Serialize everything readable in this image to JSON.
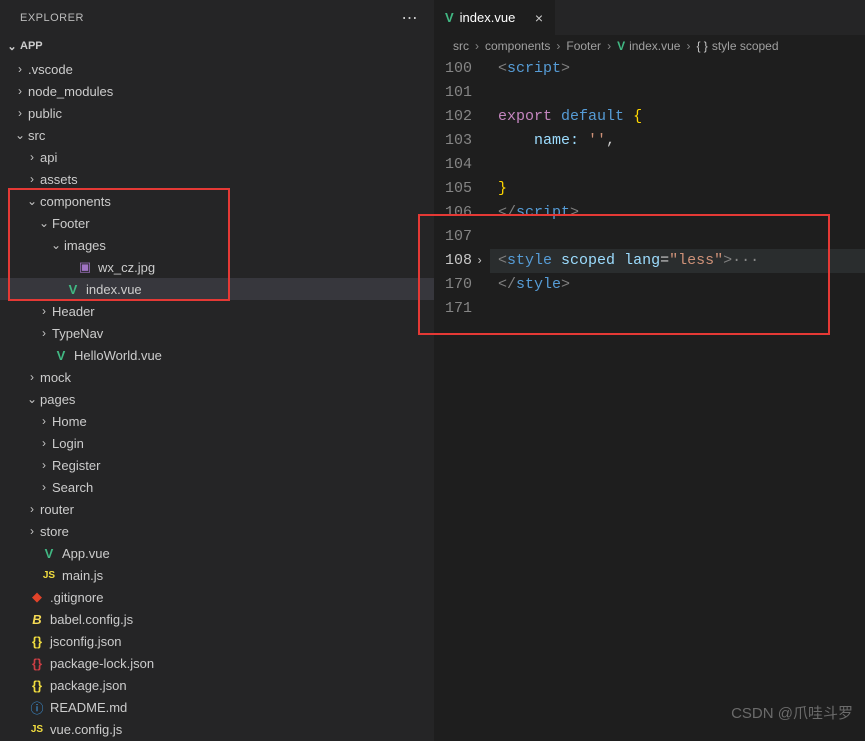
{
  "explorer": {
    "title": "EXPLORER",
    "section": "APP",
    "tree": [
      {
        "indent": 1,
        "chev": "›",
        "icon": "",
        "cls": "",
        "label": ".vscode"
      },
      {
        "indent": 1,
        "chev": "›",
        "icon": "",
        "cls": "",
        "label": "node_modules"
      },
      {
        "indent": 1,
        "chev": "›",
        "icon": "",
        "cls": "",
        "label": "public"
      },
      {
        "indent": 1,
        "chev": "⌄",
        "icon": "",
        "cls": "",
        "label": "src"
      },
      {
        "indent": 2,
        "chev": "›",
        "icon": "",
        "cls": "",
        "label": "api"
      },
      {
        "indent": 2,
        "chev": "›",
        "icon": "",
        "cls": "",
        "label": "assets"
      },
      {
        "indent": 2,
        "chev": "⌄",
        "icon": "",
        "cls": "",
        "label": "components"
      },
      {
        "indent": 3,
        "chev": "⌄",
        "icon": "",
        "cls": "",
        "label": "Footer"
      },
      {
        "indent": 4,
        "chev": "⌄",
        "icon": "",
        "cls": "",
        "label": "images"
      },
      {
        "indent": 5,
        "chev": "",
        "icon": "▣",
        "cls": "ic-img",
        "label": "wx_cz.jpg"
      },
      {
        "indent": 4,
        "chev": "",
        "icon": "V",
        "cls": "ic-vue",
        "label": "index.vue",
        "selected": true
      },
      {
        "indent": 3,
        "chev": "›",
        "icon": "",
        "cls": "",
        "label": "Header"
      },
      {
        "indent": 3,
        "chev": "›",
        "icon": "",
        "cls": "",
        "label": "TypeNav"
      },
      {
        "indent": 3,
        "chev": "",
        "icon": "V",
        "cls": "ic-vue",
        "label": "HelloWorld.vue"
      },
      {
        "indent": 2,
        "chev": "›",
        "icon": "",
        "cls": "",
        "label": "mock"
      },
      {
        "indent": 2,
        "chev": "⌄",
        "icon": "",
        "cls": "",
        "label": "pages"
      },
      {
        "indent": 3,
        "chev": "›",
        "icon": "",
        "cls": "",
        "label": "Home"
      },
      {
        "indent": 3,
        "chev": "›",
        "icon": "",
        "cls": "",
        "label": "Login"
      },
      {
        "indent": 3,
        "chev": "›",
        "icon": "",
        "cls": "",
        "label": "Register"
      },
      {
        "indent": 3,
        "chev": "›",
        "icon": "",
        "cls": "",
        "label": "Search"
      },
      {
        "indent": 2,
        "chev": "›",
        "icon": "",
        "cls": "",
        "label": "router"
      },
      {
        "indent": 2,
        "chev": "›",
        "icon": "",
        "cls": "",
        "label": "store"
      },
      {
        "indent": 2,
        "chev": "",
        "icon": "V",
        "cls": "ic-vue",
        "label": "App.vue"
      },
      {
        "indent": 2,
        "chev": "",
        "icon": "JS",
        "cls": "ic-js",
        "label": "main.js"
      },
      {
        "indent": 1,
        "chev": "",
        "icon": "◆",
        "cls": "ic-git",
        "label": ".gitignore"
      },
      {
        "indent": 1,
        "chev": "",
        "icon": "B",
        "cls": "ic-babel",
        "label": "babel.config.js"
      },
      {
        "indent": 1,
        "chev": "",
        "icon": "{}",
        "cls": "ic-json",
        "label": "jsconfig.json"
      },
      {
        "indent": 1,
        "chev": "",
        "icon": "{}",
        "cls": "ic-json-lock",
        "label": "package-lock.json"
      },
      {
        "indent": 1,
        "chev": "",
        "icon": "{}",
        "cls": "ic-json",
        "label": "package.json"
      },
      {
        "indent": 1,
        "chev": "",
        "icon": "ⓘ",
        "cls": "ic-readme",
        "label": "README.md"
      },
      {
        "indent": 1,
        "chev": "",
        "icon": "JS",
        "cls": "ic-js",
        "label": "vue.config.js"
      }
    ]
  },
  "tab": {
    "icon": "V",
    "label": "index.vue"
  },
  "breadcrumbs": {
    "b1": "src",
    "b2": "components",
    "b3": "Footer",
    "b4": "index.vue",
    "b5": "style scoped"
  },
  "code": {
    "lineNums": [
      "100",
      "101",
      "102",
      "103",
      "104",
      "105",
      "106",
      "107",
      "108",
      "170",
      "171"
    ],
    "currentIdx": 8,
    "l100": {
      "a": "<",
      "b": "script",
      "c": ">"
    },
    "l102": {
      "a": "export",
      "b": "default",
      "c": "{"
    },
    "l103": {
      "a": "name:",
      "b": "''",
      "c": ","
    },
    "l105": {
      "a": "}"
    },
    "l106": {
      "a": "</",
      "b": "script",
      "c": ">"
    },
    "l108": {
      "a": "<",
      "b": "style",
      "c": "scoped",
      "d": "lang",
      "e": "=",
      "f": "\"less\"",
      "g": ">",
      "h": "···"
    },
    "l170": {
      "a": "</",
      "b": "style",
      "c": ">"
    }
  },
  "watermark": "CSDN @爪哇斗罗"
}
